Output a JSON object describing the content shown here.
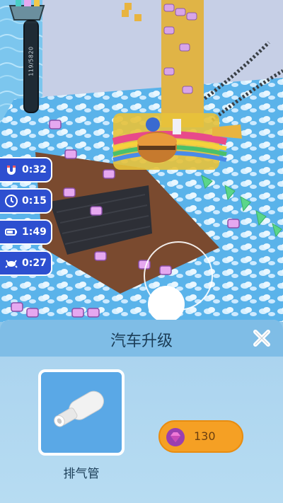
{
  "progress": {
    "label": "119/5820",
    "fraction": 0.02
  },
  "boosts": [
    {
      "icon": "magnet-icon",
      "time": "0:32"
    },
    {
      "icon": "clock-icon",
      "time": "0:15"
    },
    {
      "icon": "battery-icon",
      "time": "1:49"
    },
    {
      "icon": "crab-icon",
      "time": "0:27"
    }
  ],
  "panel": {
    "title": "汽车升级",
    "close_icon": "close-icon"
  },
  "upgrade_item": {
    "name": "排气管",
    "icon": "exhaust-pipe-icon"
  },
  "price": {
    "icon": "gem-icon",
    "amount": "130"
  },
  "colors": {
    "accent": "#f5a024",
    "boost_bg": "#2d4fd0",
    "panel": "#a8d2ee",
    "header": "#7fbde6"
  }
}
